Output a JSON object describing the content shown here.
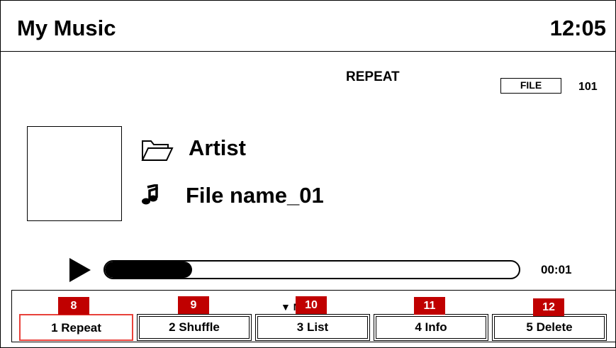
{
  "header": {
    "title": "My Music",
    "clock": "12:05"
  },
  "status": {
    "mode": "REPEAT",
    "source_badge": "FILE",
    "file_count": "101"
  },
  "track": {
    "artist": "Artist",
    "file_name": "File name_01"
  },
  "playback": {
    "elapsed": "00:01",
    "progress_fraction": 0.21
  },
  "menu": {
    "label": "▼ MENU"
  },
  "softkeys": [
    {
      "label": "1  Repeat",
      "tag": "8"
    },
    {
      "label": "2  Shuffle",
      "tag": "9"
    },
    {
      "label": "3  List",
      "tag": "10"
    },
    {
      "label": "4  Info",
      "tag": "11"
    },
    {
      "label": "5 Delete",
      "tag": "12"
    }
  ],
  "colors": {
    "active_outline": "#e8413a",
    "tag_background": "#c00000"
  },
  "icons": {
    "folder": "folder-icon",
    "track": "music-note-icon",
    "play": "play-icon"
  }
}
